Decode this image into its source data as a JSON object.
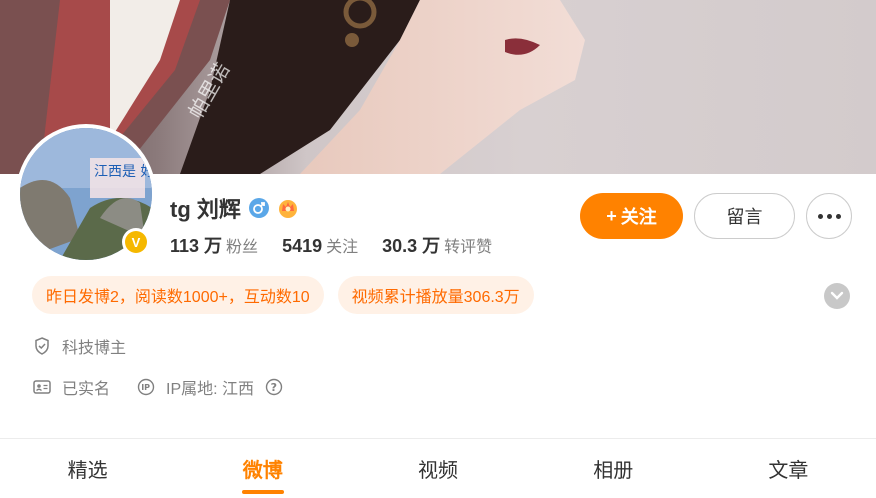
{
  "profile": {
    "name": "tg 刘辉",
    "verified_label": "V",
    "stats": [
      {
        "num": "113 万",
        "label": "粉丝"
      },
      {
        "num": "5419",
        "label": "关注"
      },
      {
        "num": "30.3 万",
        "label": "转评赞"
      }
    ],
    "avatar_text": "江西是 好地方"
  },
  "cover": {
    "watermark": "帕里诺"
  },
  "actions": {
    "follow_icon": "+",
    "follow_label": "关注",
    "message_label": "留言"
  },
  "tags": [
    "昨日发博2，阅读数1000+，互动数10",
    "视频累计播放量306.3万"
  ],
  "info": {
    "category": "科技博主",
    "real_name": "已实名",
    "ip_label": "IP属地: 江西"
  },
  "tabs": [
    {
      "label": "精选",
      "active": false
    },
    {
      "label": "微博",
      "active": true
    },
    {
      "label": "视频",
      "active": false
    },
    {
      "label": "相册",
      "active": false
    },
    {
      "label": "文章",
      "active": false
    }
  ],
  "colors": {
    "accent": "#ff8200",
    "tag_bg": "#fff1e6",
    "tag_text": "#ff6a00",
    "verified": "#f5b800",
    "gender": "#5aa7e8"
  },
  "icons": {
    "gender": "male-icon",
    "vip": "crown-badge-icon",
    "more": "more-dots-icon",
    "expand": "chevron-down-icon",
    "category": "shield-icon",
    "real_name": "id-card-icon",
    "ip": "ip-location-icon",
    "ip_help": "question-icon"
  }
}
